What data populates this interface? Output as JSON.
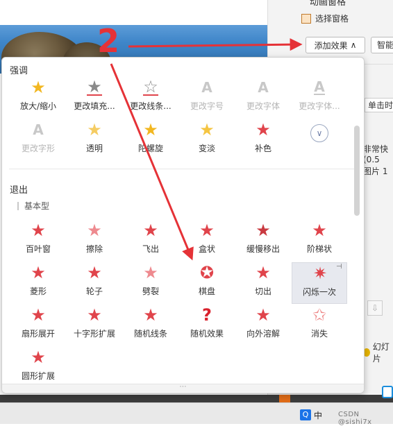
{
  "right_panel": {
    "title_partial": "动画窗格",
    "select_pane": "选择窗格",
    "add_effect": "添加效果",
    "smart": "智能",
    "single_click": "单击时",
    "speed": "非常快(0.5",
    "picture": "图片 1",
    "slideshow": "幻灯片"
  },
  "annotation": {
    "number": "2",
    "color": "#e53237"
  },
  "panel": {
    "emphasis_title": "强调",
    "emphasis_items": [
      {
        "label": "放大/缩小",
        "icon": "grow-shrink-star-icon",
        "enabled": true
      },
      {
        "label": "更改填充...",
        "icon": "change-fill-star-icon",
        "enabled": true
      },
      {
        "label": "更改线条...",
        "icon": "change-line-star-icon",
        "enabled": true
      },
      {
        "label": "更改字号",
        "icon": "change-font-size-icon",
        "enabled": false
      },
      {
        "label": "更改字体",
        "icon": "change-font-icon",
        "enabled": false
      },
      {
        "label": "更改字体...",
        "icon": "change-font-color-icon",
        "enabled": false
      },
      {
        "label": "更改字形",
        "icon": "change-font-style-icon",
        "enabled": false
      },
      {
        "label": "透明",
        "icon": "transparency-star-icon",
        "enabled": true
      },
      {
        "label": "陀螺旋",
        "icon": "spin-star-icon",
        "enabled": true
      },
      {
        "label": "变淡",
        "icon": "lighten-star-icon",
        "enabled": true
      },
      {
        "label": "补色",
        "icon": "complementary-color-star-icon",
        "enabled": true
      }
    ],
    "exit_title": "退出",
    "exit_subtitle": "基本型",
    "exit_items": [
      {
        "label": "百叶窗",
        "icon": "blinds-star-icon"
      },
      {
        "label": "擦除",
        "icon": "wipe-star-icon"
      },
      {
        "label": "飞出",
        "icon": "fly-out-star-icon"
      },
      {
        "label": "盒状",
        "icon": "box-star-icon"
      },
      {
        "label": "缓慢移出",
        "icon": "crawl-out-star-icon"
      },
      {
        "label": "阶梯状",
        "icon": "diagonal-squares-star-icon"
      },
      {
        "label": "菱形",
        "icon": "diamond-star-icon"
      },
      {
        "label": "轮子",
        "icon": "wheel-star-icon"
      },
      {
        "label": "劈裂",
        "icon": "split-star-icon"
      },
      {
        "label": "棋盘",
        "icon": "checkerboard-star-icon"
      },
      {
        "label": "切出",
        "icon": "cut-star-icon"
      },
      {
        "label": "闪烁一次",
        "icon": "flash-once-star-icon"
      },
      {
        "label": "扇形展开",
        "icon": "fan-out-star-icon"
      },
      {
        "label": "十字形扩展",
        "icon": "plus-expand-star-icon"
      },
      {
        "label": "随机线条",
        "icon": "random-bars-star-icon"
      },
      {
        "label": "随机效果",
        "icon": "random-effect-question-icon"
      },
      {
        "label": "向外溶解",
        "icon": "dissolve-out-star-icon"
      },
      {
        "label": "消失",
        "icon": "disappear-star-icon"
      },
      {
        "label": "圆形扩展",
        "icon": "circle-expand-star-icon"
      }
    ]
  },
  "taskbar": {
    "input_method": "中",
    "watermark": "CSDN @sishi7x"
  },
  "colors": {
    "gold_star": "#f2b721",
    "red_star": "#e0444b",
    "disabled": "#b5b5b5",
    "accent_arrow": "#e53237"
  }
}
